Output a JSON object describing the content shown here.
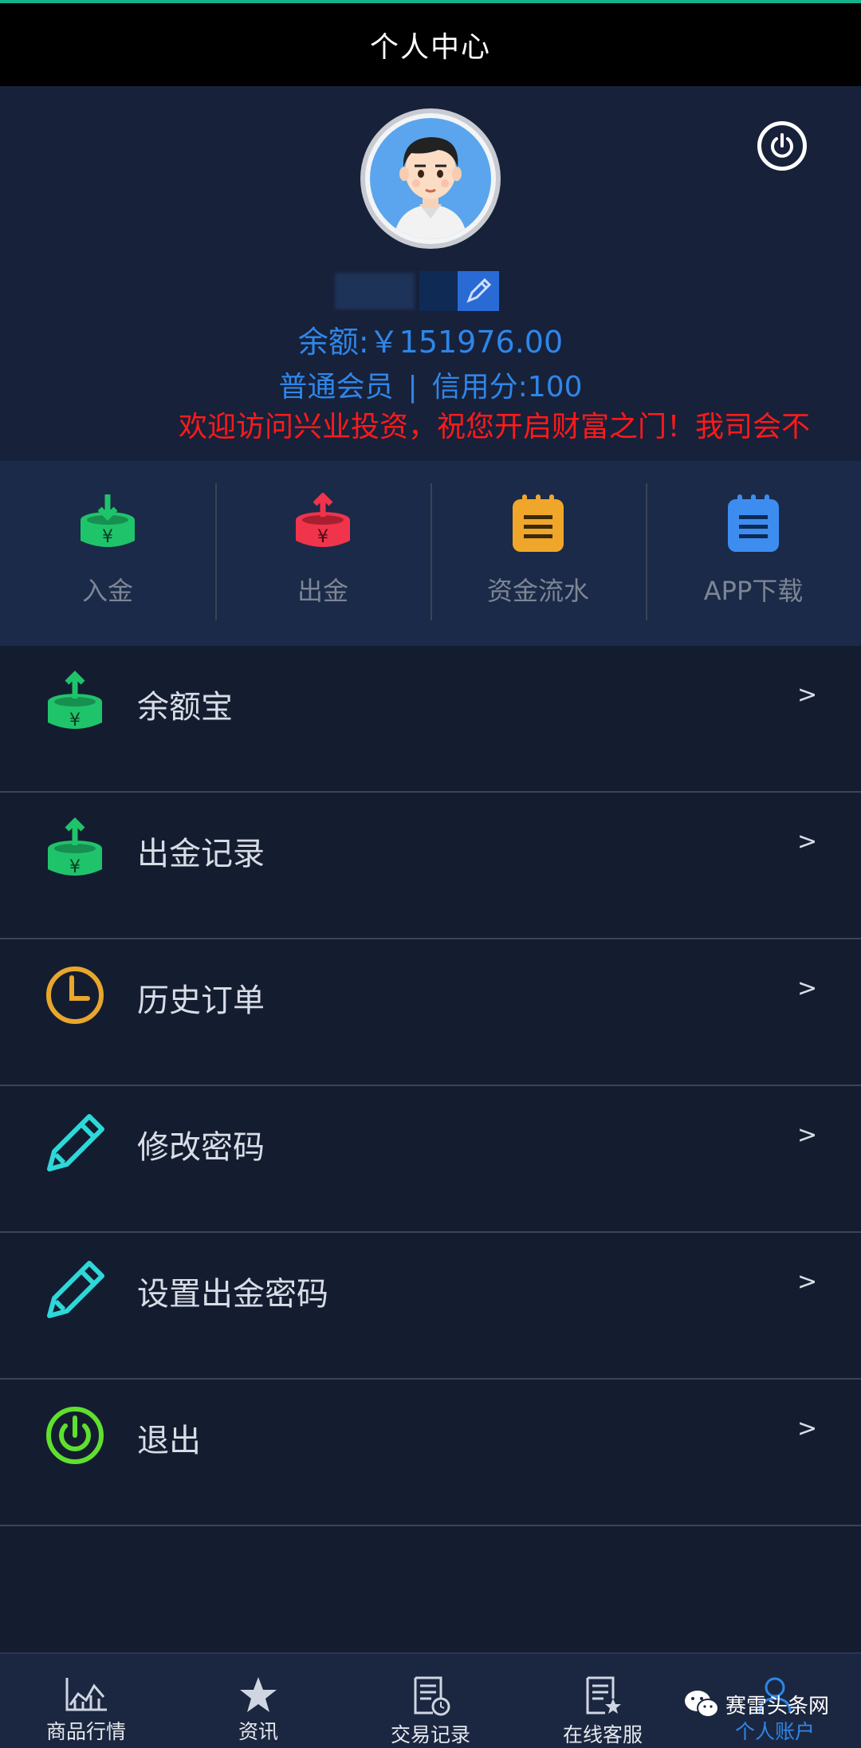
{
  "header": {
    "title": "个人中心"
  },
  "profile": {
    "balance_text": "余额:￥151976.00",
    "member_level": "普通会员",
    "separator": "|",
    "credit_text": "信用分:100",
    "marquee_text": "欢迎访问兴业投资，祝您开启财富之门！我司会不"
  },
  "quick_actions": [
    {
      "label": "入金",
      "icon": "deposit-icon",
      "color": "#1fc46a"
    },
    {
      "label": "出金",
      "icon": "withdraw-icon",
      "color": "#f0344c"
    },
    {
      "label": "资金流水",
      "icon": "notepad-icon",
      "color": "#f0a62a"
    },
    {
      "label": "APP下载",
      "icon": "notepad-icon",
      "color": "#3d8df0"
    }
  ],
  "menu": [
    {
      "label": "余额宝",
      "icon": "deposit-icon",
      "chevron": ">"
    },
    {
      "label": "出金记录",
      "icon": "deposit-icon",
      "chevron": ">"
    },
    {
      "label": "历史订单",
      "icon": "clock-icon",
      "chevron": ">"
    },
    {
      "label": "修改密码",
      "icon": "pencil-icon",
      "chevron": ">"
    },
    {
      "label": "设置出金密码",
      "icon": "pencil-icon",
      "chevron": ">"
    },
    {
      "label": "退出",
      "icon": "power-icon",
      "chevron": ">"
    }
  ],
  "tabs": [
    {
      "label": "商品行情",
      "icon": "chart-icon"
    },
    {
      "label": "资讯",
      "icon": "star-icon"
    },
    {
      "label": "交易记录",
      "icon": "document-clock-icon"
    },
    {
      "label": "在线客服",
      "icon": "document-star-icon"
    },
    {
      "label": "个人账户",
      "icon": "user-icon",
      "active": true
    }
  ],
  "brand": {
    "name": "赛雷头条网",
    "icon": "wechat-icon"
  },
  "colors": {
    "background": "#141d30",
    "accent_blue": "#2f86e8",
    "marquee_red": "#ff1a1a",
    "green": "#1fc46a"
  }
}
